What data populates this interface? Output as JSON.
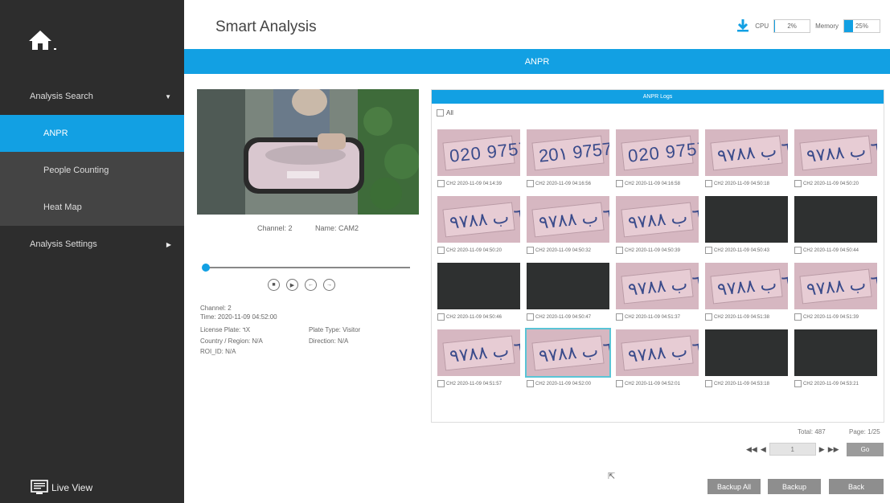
{
  "sidebar": {
    "analysis_search": "Analysis Search",
    "items": [
      {
        "label": "ANPR"
      },
      {
        "label": "People Counting"
      },
      {
        "label": "Heat Map"
      }
    ],
    "analysis_settings": "Analysis Settings",
    "live_view": "Live View"
  },
  "header": {
    "title": "Smart Analysis",
    "cpu_label": "CPU",
    "cpu_value": "2%",
    "cpu_level": 0.02,
    "memory_label": "Memory",
    "memory_value": "25%",
    "memory_level": 0.25
  },
  "banner": "ANPR",
  "playback": {
    "channel_caption": "Channel: 2",
    "name_caption": "Name: CAM2",
    "progress": 0
  },
  "details": {
    "channel": "Channel: 2",
    "time": "Time: 2020-11-09 04:52:00",
    "license_plate": "License Plate: ٦X",
    "plate_type": "Plate Type: Visitor",
    "country": "Country / Region: N/A",
    "direction": "Direction: N/A",
    "roi": "ROI_ID: N/A"
  },
  "logs": {
    "title": "ANPR Logs",
    "all_label": "All",
    "entries": [
      {
        "caption": "CH2 2020-11-09 04:14:39",
        "plate": "020 9757"
      },
      {
        "caption": "CH2 2020-11-09 04:16:56",
        "plate": "20١ 9757"
      },
      {
        "caption": "CH2 2020-11-09 04:16:58",
        "plate": "020 9757"
      },
      {
        "caption": "CH2 2020-11-09 04:50:18",
        "plate": "٦١ ب ٩٧٨٨"
      },
      {
        "caption": "CH2 2020-11-09 04:50:20",
        "plate": "٦١ ب ٩٧٨٨"
      },
      {
        "caption": "CH2 2020-11-09 04:50:20",
        "plate": "٦١ ب ٩٧٨٨"
      },
      {
        "caption": "CH2 2020-11-09 04:50:32",
        "plate": "٦١ ب ٩٧٨٨"
      },
      {
        "caption": "CH2 2020-11-09 04:50:39",
        "plate": "٦١ ب ٩٧٨٨"
      },
      {
        "caption": "CH2 2020-11-09 04:50:43",
        "plate": ""
      },
      {
        "caption": "CH2 2020-11-09 04:50:44",
        "plate": ""
      },
      {
        "caption": "CH2 2020-11-09 04:50:46",
        "plate": ""
      },
      {
        "caption": "CH2 2020-11-09 04:50:47",
        "plate": ""
      },
      {
        "caption": "CH2 2020-11-09 04:51:37",
        "plate": "٦١ ب ٩٧٨٨"
      },
      {
        "caption": "CH2 2020-11-09 04:51:38",
        "plate": "٦١ ب ٩٧٨٨"
      },
      {
        "caption": "CH2 2020-11-09 04:51:39",
        "plate": "٦١ ب ٩٧٨٨"
      },
      {
        "caption": "CH2 2020-11-09 04:51:57",
        "plate": "٦١ ب ٩٧٨٨"
      },
      {
        "caption": "CH2 2020-11-09 04:52:00",
        "plate": "٦١ ب ٩٧٨٨"
      },
      {
        "caption": "CH2 2020-11-09 04:52:01",
        "plate": "٦١ ب ٩٧٨٨"
      },
      {
        "caption": "CH2 2020-11-09 04:53:18",
        "plate": ""
      },
      {
        "caption": "CH2 2020-11-09 04:53:21",
        "plate": ""
      }
    ],
    "selected_index": 16
  },
  "footer": {
    "total": "Total: 487",
    "page": "Page: 1/25",
    "page_input": "1",
    "go": "Go",
    "backup_all": "Backup All",
    "backup": "Backup",
    "back": "Back"
  },
  "colors": {
    "accent": "#12a0e3",
    "sidebar_bg": "#2d2d2d",
    "sidebar_item_bg": "#444444",
    "button_gray": "#8e8e8e"
  }
}
